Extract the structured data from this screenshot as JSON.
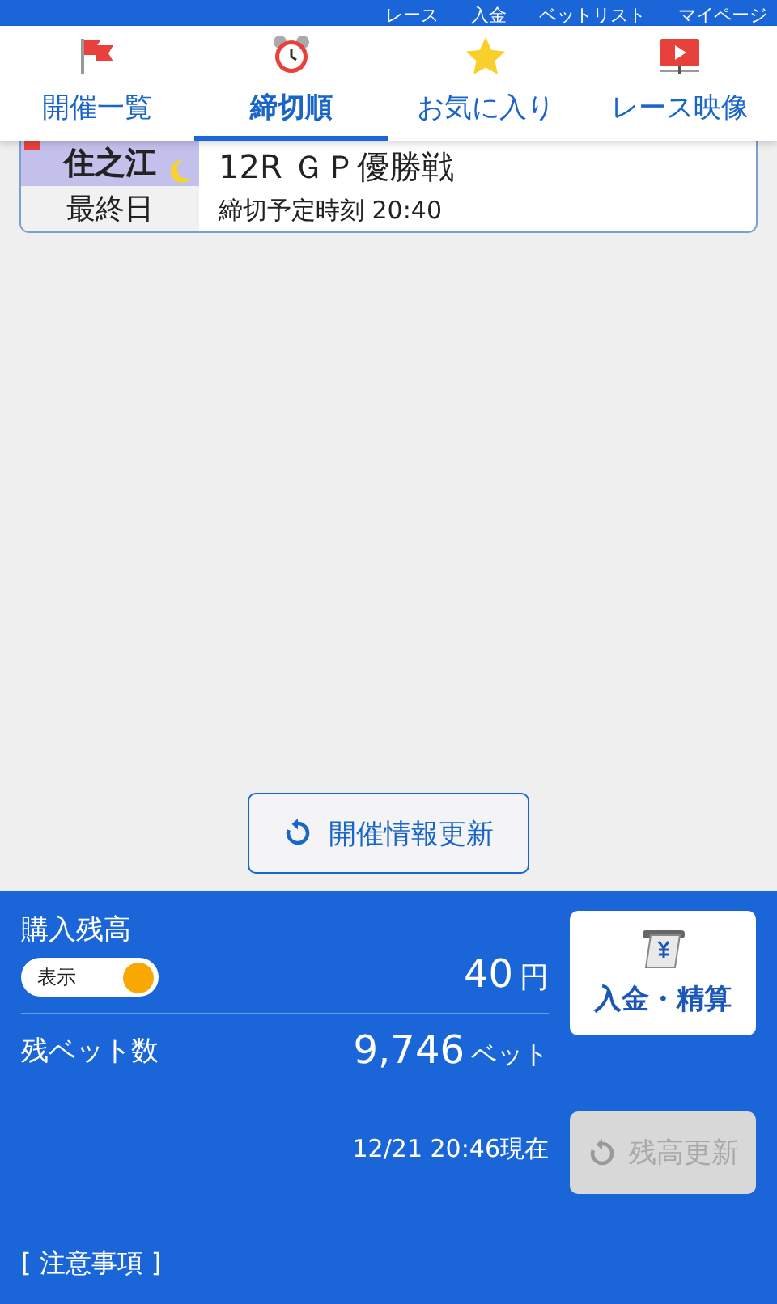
{
  "top_nav": [
    {
      "label": "レース"
    },
    {
      "label": "入金"
    },
    {
      "label": "ベットリスト"
    },
    {
      "label": "マイページ"
    }
  ],
  "tabs": [
    {
      "label": "開催一覧",
      "kind": "flag",
      "selected": false
    },
    {
      "label": "締切順",
      "kind": "clock",
      "selected": true
    },
    {
      "label": "お気に入り",
      "kind": "star",
      "selected": false
    },
    {
      "label": "レース映像",
      "kind": "video",
      "selected": false
    }
  ],
  "races": [
    {
      "venue": "住之江",
      "night": true,
      "day": "最終日",
      "race": "12R ＧＰ優勝戦",
      "deadline": "締切予定時刻 20:40"
    }
  ],
  "refresh_button": "開催情報更新",
  "balance": {
    "label": "購入残高",
    "toggle": {
      "label": "表示",
      "on": true
    },
    "amount": "40",
    "unit": "円",
    "deposit_button": "入金・精算",
    "bets_label": "残ベット数",
    "bets": "9,746",
    "bets_unit": "ベット",
    "as_of": "12/21 20:46現在",
    "update_button": {
      "label": "残高更新",
      "disabled": true
    }
  },
  "notes_heading": "[ 注意事項 ]"
}
